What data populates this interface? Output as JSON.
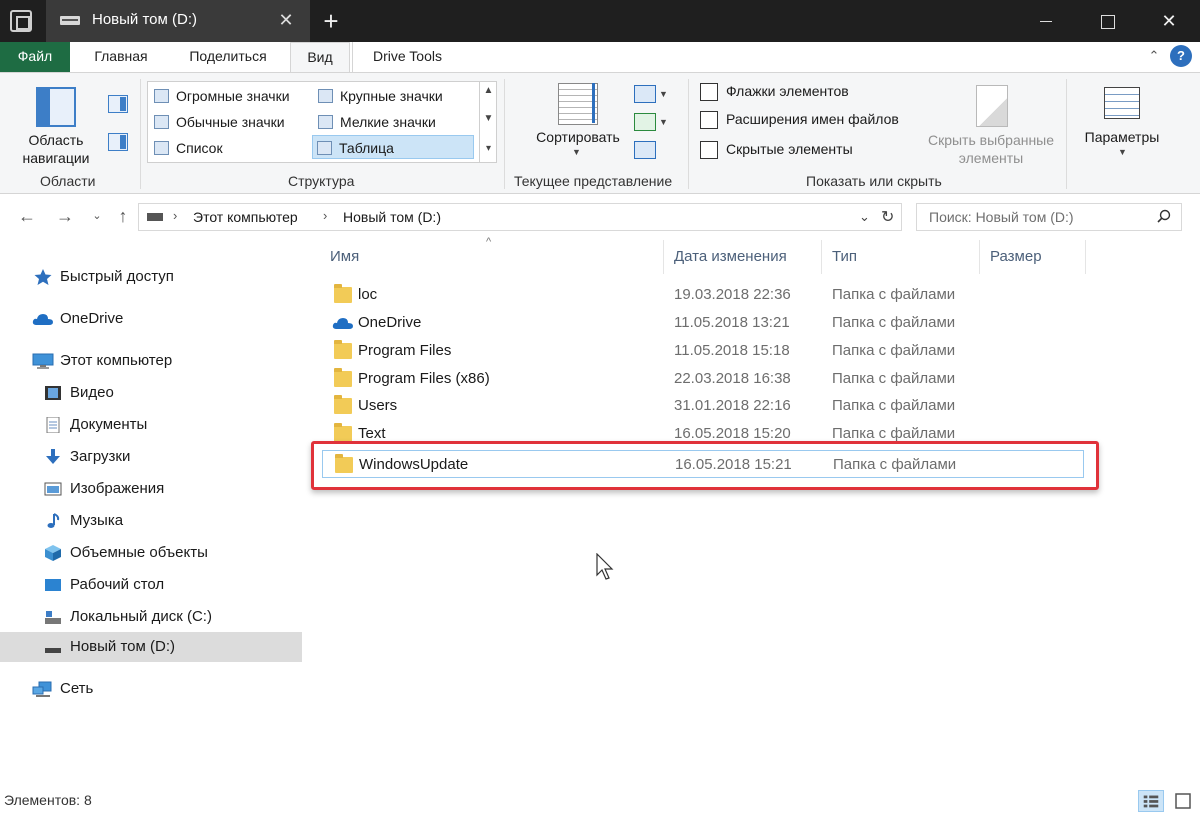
{
  "window": {
    "tab_title": "Новый том (D:)",
    "close_tab_glyph": "✕",
    "new_tab_glyph": "+",
    "close_glyph": "✕"
  },
  "ribbon_tabs": {
    "file": "Файл",
    "home": "Главная",
    "share": "Поделиться",
    "view": "Вид",
    "drive_tools": "Drive Tools"
  },
  "ribbon": {
    "nav_pane_label": "Область навигации",
    "groups": {
      "panes": "Области",
      "layout": "Структура",
      "current_view": "Текущее представление",
      "show_hide": "Показать или скрыть"
    },
    "layout_options": {
      "huge_icons": "Огромные значки",
      "large_icons": "Крупные значки",
      "medium_icons": "Обычные значки",
      "small_icons": "Мелкие значки",
      "list": "Список",
      "details": "Таблица"
    },
    "sort_label": "Сортировать",
    "checkboxes": {
      "item_checkboxes": "Флажки элементов",
      "file_extensions": "Расширения имен файлов",
      "hidden_items": "Скрытые элементы"
    },
    "hide_selected": "Скрыть выбранные элементы",
    "options": "Параметры"
  },
  "address": {
    "path": [
      "Этот компьютер",
      "Новый том (D:)"
    ],
    "search_placeholder": "Поиск: Новый том (D:)"
  },
  "sidebar": {
    "items": [
      {
        "label": "Быстрый доступ",
        "icon": "star-icon"
      },
      {
        "label": "OneDrive",
        "icon": "cloud-icon"
      },
      {
        "label": "Этот компьютер",
        "icon": "computer-icon"
      },
      {
        "label": "Видео",
        "icon": "video-icon"
      },
      {
        "label": "Документы",
        "icon": "documents-icon"
      },
      {
        "label": "Загрузки",
        "icon": "downloads-icon"
      },
      {
        "label": "Изображения",
        "icon": "pictures-icon"
      },
      {
        "label": "Музыка",
        "icon": "music-icon"
      },
      {
        "label": "Объемные объекты",
        "icon": "3d-objects-icon"
      },
      {
        "label": "Рабочий стол",
        "icon": "desktop-icon"
      },
      {
        "label": "Локальный диск (C:)",
        "icon": "local-disk-icon"
      },
      {
        "label": "Новый том (D:)",
        "icon": "drive-icon"
      },
      {
        "label": "Сеть",
        "icon": "network-icon"
      }
    ]
  },
  "columns": {
    "name": "Имя",
    "date": "Дата изменения",
    "type": "Тип",
    "size": "Размер"
  },
  "files": [
    {
      "name": "loc",
      "date": "19.03.2018 22:36",
      "type": "Папка с файлами"
    },
    {
      "name": "OneDrive",
      "date": "11.05.2018 13:21",
      "type": "Папка с файлами"
    },
    {
      "name": "Program Files",
      "date": "11.05.2018 15:18",
      "type": "Папка с файлами"
    },
    {
      "name": "Program Files (x86)",
      "date": "22.03.2018 16:38",
      "type": "Папка с файлами"
    },
    {
      "name": "Users",
      "date": "31.01.2018 22:16",
      "type": "Папка с файлами"
    },
    {
      "name": "Text",
      "date": "16.05.2018 15:20",
      "type": "Папка с файлами"
    },
    {
      "name": "WindowsUpdate",
      "date": "16.05.2018 15:21",
      "type": "Папка с файлами"
    }
  ],
  "status": {
    "items_count": "Элементов: 8"
  },
  "colors": {
    "file_tab": "#1e6c43",
    "accent_blue": "#2d6fbd",
    "highlight_frame": "#e0323a",
    "selection": "#cce4f7"
  }
}
